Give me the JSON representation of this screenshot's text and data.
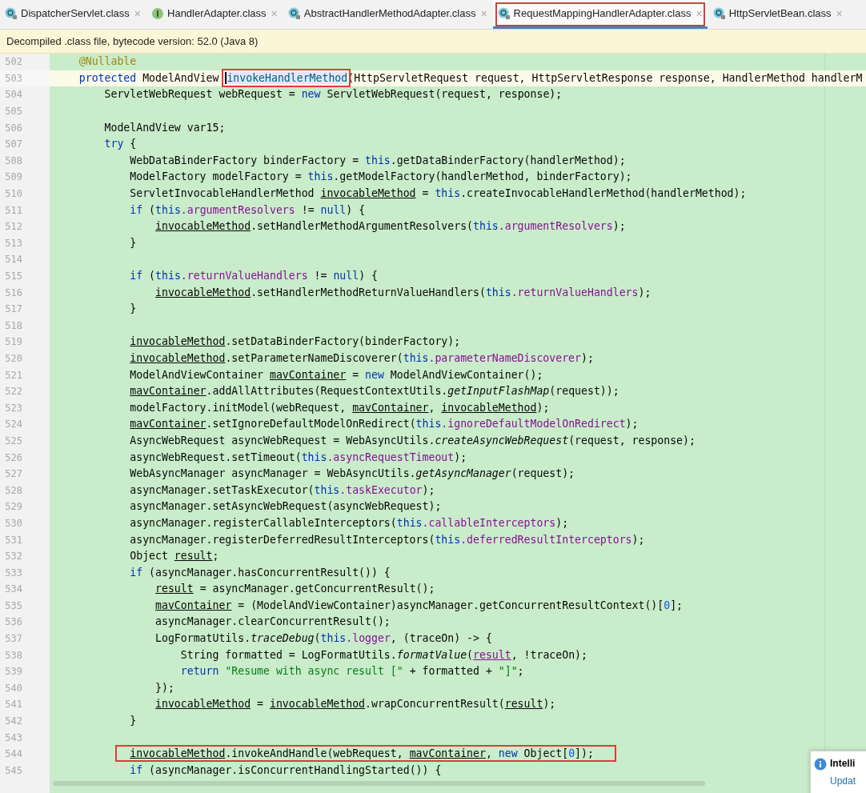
{
  "tabs": [
    {
      "label": "DispatcherServlet.class",
      "kind": "class",
      "close": "×",
      "selected": false
    },
    {
      "label": "HandlerAdapter.class",
      "kind": "interface",
      "close": "×",
      "selected": false
    },
    {
      "label": "AbstractHandlerMethodAdapter.class",
      "kind": "class",
      "close": "×",
      "selected": false
    },
    {
      "label": "RequestMappingHandlerAdapter.class",
      "kind": "class",
      "close": "×",
      "selected": true,
      "highlighted": true
    },
    {
      "label": "HttpServletBean.class",
      "kind": "class",
      "close": "×",
      "selected": false
    }
  ],
  "info_bar": {
    "text": "Decompiled .class file, bytecode version: 52.0 (Java 8)"
  },
  "editor": {
    "lines": [
      {
        "number": "502",
        "tokens": [
          {
            "kind": "annotation",
            "text": "    @Nullable"
          }
        ]
      },
      {
        "number": "503",
        "current": true,
        "tokens": [
          {
            "kind": "keyword",
            "text": "    protected"
          },
          {
            "kind": "plain",
            "text": " ModelAndView "
          },
          {
            "kind": "declaration",
            "text": "invokeHandlerMethod",
            "highlighted": true
          },
          {
            "kind": "plain",
            "text": "(HttpServletRequest request, HttpServletResponse response, HandlerMethod handlerM"
          }
        ]
      },
      {
        "number": "504",
        "tokens": [
          {
            "kind": "plain",
            "text": "        ServletWebRequest webRequest = "
          },
          {
            "kind": "keyword",
            "text": "new"
          },
          {
            "kind": "plain",
            "text": " ServletWebRequest(request, response);"
          }
        ]
      },
      {
        "number": "505"
      },
      {
        "number": "506",
        "tokens": [
          {
            "kind": "plain",
            "text": "        ModelAndView var15;"
          }
        ]
      },
      {
        "number": "507",
        "tokens": [
          {
            "kind": "keyword",
            "text": "        try"
          },
          {
            "kind": "plain",
            "text": " {"
          }
        ]
      },
      {
        "number": "508",
        "tokens": [
          {
            "kind": "plain",
            "text": "            WebDataBinderFactory binderFactory = "
          },
          {
            "kind": "keyword",
            "text": "this"
          },
          {
            "kind": "plain",
            "text": ".getDataBinderFactory(handlerMethod);"
          }
        ]
      },
      {
        "number": "509",
        "tokens": [
          {
            "kind": "plain",
            "text": "            ModelFactory modelFactory = "
          },
          {
            "kind": "keyword",
            "text": "this"
          },
          {
            "kind": "plain",
            "text": ".getModelFactory(handlerMethod, binderFactory);"
          }
        ]
      },
      {
        "number": "510",
        "tokens": [
          {
            "kind": "plain",
            "text": "            ServletInvocableHandlerMethod "
          },
          {
            "kind": "variable",
            "text": "invocableMethod"
          },
          {
            "kind": "plain",
            "text": " = "
          },
          {
            "kind": "keyword",
            "text": "this"
          },
          {
            "kind": "plain",
            "text": ".createInvocableHandlerMethod(handlerMethod);"
          }
        ]
      },
      {
        "number": "511",
        "tokens": [
          {
            "kind": "keyword",
            "text": "            if"
          },
          {
            "kind": "plain",
            "text": " ("
          },
          {
            "kind": "keyword",
            "text": "this"
          },
          {
            "kind": "field",
            "text": ".argumentResolvers"
          },
          {
            "kind": "plain",
            "text": " != "
          },
          {
            "kind": "keyword",
            "text": "null"
          },
          {
            "kind": "plain",
            "text": ") {"
          }
        ]
      },
      {
        "number": "512",
        "tokens": [
          {
            "kind": "variable",
            "text": "                invocableMethod"
          },
          {
            "kind": "plain",
            "text": ".setHandlerMethodArgumentResolvers("
          },
          {
            "kind": "keyword",
            "text": "this"
          },
          {
            "kind": "field",
            "text": ".argumentResolvers"
          },
          {
            "kind": "plain",
            "text": ");"
          }
        ]
      },
      {
        "number": "513",
        "tokens": [
          {
            "kind": "plain",
            "text": "            }"
          }
        ]
      },
      {
        "number": "514"
      },
      {
        "number": "515",
        "tokens": [
          {
            "kind": "keyword",
            "text": "            if"
          },
          {
            "kind": "plain",
            "text": " ("
          },
          {
            "kind": "keyword",
            "text": "this"
          },
          {
            "kind": "field",
            "text": ".returnValueHandlers"
          },
          {
            "kind": "plain",
            "text": " != "
          },
          {
            "kind": "keyword",
            "text": "null"
          },
          {
            "kind": "plain",
            "text": ") {"
          }
        ]
      },
      {
        "number": "516",
        "tokens": [
          {
            "kind": "variable",
            "text": "                invocableMethod"
          },
          {
            "kind": "plain",
            "text": ".setHandlerMethodReturnValueHandlers("
          },
          {
            "kind": "keyword",
            "text": "this"
          },
          {
            "kind": "field",
            "text": ".returnValueHandlers"
          },
          {
            "kind": "plain",
            "text": ");"
          }
        ]
      },
      {
        "number": "517",
        "tokens": [
          {
            "kind": "plain",
            "text": "            }"
          }
        ]
      },
      {
        "number": "518"
      },
      {
        "number": "519",
        "tokens": [
          {
            "kind": "variable",
            "text": "            invocableMethod"
          },
          {
            "kind": "plain",
            "text": ".setDataBinderFactory(binderFactory);"
          }
        ]
      },
      {
        "number": "520",
        "tokens": [
          {
            "kind": "variable",
            "text": "            invocableMethod"
          },
          {
            "kind": "plain",
            "text": ".setParameterNameDiscoverer("
          },
          {
            "kind": "keyword",
            "text": "this"
          },
          {
            "kind": "field",
            "text": ".parameterNameDiscoverer"
          },
          {
            "kind": "plain",
            "text": ");"
          }
        ]
      },
      {
        "number": "521",
        "tokens": [
          {
            "kind": "plain",
            "text": "            ModelAndViewContainer "
          },
          {
            "kind": "variable",
            "text": "mavContainer"
          },
          {
            "kind": "plain",
            "text": " = "
          },
          {
            "kind": "keyword",
            "text": "new"
          },
          {
            "kind": "plain",
            "text": " ModelAndViewContainer();"
          }
        ]
      },
      {
        "number": "522",
        "tokens": [
          {
            "kind": "variable",
            "text": "            mavContainer"
          },
          {
            "kind": "plain",
            "text": ".addAllAttributes(RequestContextUtils."
          },
          {
            "kind": "static",
            "text": "getInputFlashMap"
          },
          {
            "kind": "plain",
            "text": "(request));"
          }
        ]
      },
      {
        "number": "523",
        "tokens": [
          {
            "kind": "plain",
            "text": "            modelFactory.initModel(webRequest, "
          },
          {
            "kind": "variable",
            "text": "mavContainer"
          },
          {
            "kind": "plain",
            "text": ", "
          },
          {
            "kind": "variable",
            "text": "invocableMethod"
          },
          {
            "kind": "plain",
            "text": ");"
          }
        ]
      },
      {
        "number": "524",
        "tokens": [
          {
            "kind": "variable",
            "text": "            mavContainer"
          },
          {
            "kind": "plain",
            "text": ".setIgnoreDefaultModelOnRedirect("
          },
          {
            "kind": "keyword",
            "text": "this"
          },
          {
            "kind": "field",
            "text": ".ignoreDefaultModelOnRedirect"
          },
          {
            "kind": "plain",
            "text": ");"
          }
        ]
      },
      {
        "number": "525",
        "tokens": [
          {
            "kind": "plain",
            "text": "            AsyncWebRequest asyncWebRequest = WebAsyncUtils."
          },
          {
            "kind": "static",
            "text": "createAsyncWebRequest"
          },
          {
            "kind": "plain",
            "text": "(request, response);"
          }
        ]
      },
      {
        "number": "526",
        "tokens": [
          {
            "kind": "plain",
            "text": "            asyncWebRequest.setTimeout("
          },
          {
            "kind": "keyword",
            "text": "this"
          },
          {
            "kind": "field",
            "text": ".asyncRequestTimeout"
          },
          {
            "kind": "plain",
            "text": ");"
          }
        ]
      },
      {
        "number": "527",
        "tokens": [
          {
            "kind": "plain",
            "text": "            WebAsyncManager asyncManager = WebAsyncUtils."
          },
          {
            "kind": "static",
            "text": "getAsyncManager"
          },
          {
            "kind": "plain",
            "text": "(request);"
          }
        ]
      },
      {
        "number": "528",
        "tokens": [
          {
            "kind": "plain",
            "text": "            asyncManager.setTaskExecutor("
          },
          {
            "kind": "keyword",
            "text": "this"
          },
          {
            "kind": "field",
            "text": ".taskExecutor"
          },
          {
            "kind": "plain",
            "text": ");"
          }
        ]
      },
      {
        "number": "529",
        "tokens": [
          {
            "kind": "plain",
            "text": "            asyncManager.setAsyncWebRequest(asyncWebRequest);"
          }
        ]
      },
      {
        "number": "530",
        "tokens": [
          {
            "kind": "plain",
            "text": "            asyncManager.registerCallableInterceptors("
          },
          {
            "kind": "keyword",
            "text": "this"
          },
          {
            "kind": "field",
            "text": ".callableInterceptors"
          },
          {
            "kind": "plain",
            "text": ");"
          }
        ]
      },
      {
        "number": "531",
        "tokens": [
          {
            "kind": "plain",
            "text": "            asyncManager.registerDeferredResultInterceptors("
          },
          {
            "kind": "keyword",
            "text": "this"
          },
          {
            "kind": "field",
            "text": ".deferredResultInterceptors"
          },
          {
            "kind": "plain",
            "text": ");"
          }
        ]
      },
      {
        "number": "532",
        "tokens": [
          {
            "kind": "plain",
            "text": "            Object "
          },
          {
            "kind": "variable",
            "text": "result"
          },
          {
            "kind": "plain",
            "text": ";"
          }
        ]
      },
      {
        "number": "533",
        "tokens": [
          {
            "kind": "keyword",
            "text": "            if"
          },
          {
            "kind": "plain",
            "text": " (asyncManager.hasConcurrentResult()) {"
          }
        ]
      },
      {
        "number": "534",
        "tokens": [
          {
            "kind": "variable",
            "text": "                result"
          },
          {
            "kind": "plain",
            "text": " = asyncManager.getConcurrentResult();"
          }
        ]
      },
      {
        "number": "535",
        "tokens": [
          {
            "kind": "variable",
            "text": "                mavContainer"
          },
          {
            "kind": "plain",
            "text": " = (ModelAndViewContainer)asyncManager.getConcurrentResultContext()["
          },
          {
            "kind": "number",
            "text": "0"
          },
          {
            "kind": "plain",
            "text": "];"
          }
        ]
      },
      {
        "number": "536",
        "tokens": [
          {
            "kind": "plain",
            "text": "                asyncManager.clearConcurrentResult();"
          }
        ]
      },
      {
        "number": "537",
        "tokens": [
          {
            "kind": "plain",
            "text": "                LogFormatUtils."
          },
          {
            "kind": "static",
            "text": "traceDebug"
          },
          {
            "kind": "plain",
            "text": "("
          },
          {
            "kind": "keyword",
            "text": "this"
          },
          {
            "kind": "field",
            "text": ".logger"
          },
          {
            "kind": "plain",
            "text": ", (traceOn) -> {"
          }
        ]
      },
      {
        "number": "538",
        "tokens": [
          {
            "kind": "plain",
            "text": "                    String formatted = LogFormatUtils."
          },
          {
            "kind": "static",
            "text": "formatValue"
          },
          {
            "kind": "plain",
            "text": "("
          },
          {
            "kind": "captured",
            "text": "result"
          },
          {
            "kind": "plain",
            "text": ", !traceOn);"
          }
        ]
      },
      {
        "number": "539",
        "tokens": [
          {
            "kind": "keyword",
            "text": "                    return"
          },
          {
            "kind": "string",
            "text": " \"Resume with async result [\""
          },
          {
            "kind": "plain",
            "text": " + formatted + "
          },
          {
            "kind": "string",
            "text": "\"]\""
          },
          {
            "kind": "plain",
            "text": ";"
          }
        ]
      },
      {
        "number": "540",
        "tokens": [
          {
            "kind": "plain",
            "text": "                });"
          }
        ]
      },
      {
        "number": "541",
        "tokens": [
          {
            "kind": "variable",
            "text": "                invocableMethod"
          },
          {
            "kind": "plain",
            "text": " = "
          },
          {
            "kind": "variable",
            "text": "invocableMethod"
          },
          {
            "kind": "plain",
            "text": ".wrapConcurrentResult("
          },
          {
            "kind": "variable",
            "text": "result"
          },
          {
            "kind": "plain",
            "text": ");"
          }
        ]
      },
      {
        "number": "542",
        "tokens": [
          {
            "kind": "plain",
            "text": "            }"
          }
        ]
      },
      {
        "number": "543"
      },
      {
        "number": "544",
        "highlighted": true,
        "tokens": [
          {
            "kind": "variable",
            "text": "            invocableMethod"
          },
          {
            "kind": "plain",
            "text": ".invokeAndHandle(webRequest, "
          },
          {
            "kind": "variable",
            "text": "mavContainer"
          },
          {
            "kind": "plain",
            "text": ", "
          },
          {
            "kind": "keyword",
            "text": "new"
          },
          {
            "kind": "plain",
            "text": " Object["
          },
          {
            "kind": "number",
            "text": "0"
          },
          {
            "kind": "plain",
            "text": "]);"
          }
        ]
      },
      {
        "number": "545",
        "tokens": [
          {
            "kind": "keyword",
            "text": "            if"
          },
          {
            "kind": "plain",
            "text": " (asyncManager.isConcurrentHandlingStarted()) {"
          }
        ]
      }
    ]
  },
  "notification": {
    "title": "Intelli",
    "link": "Updat"
  }
}
